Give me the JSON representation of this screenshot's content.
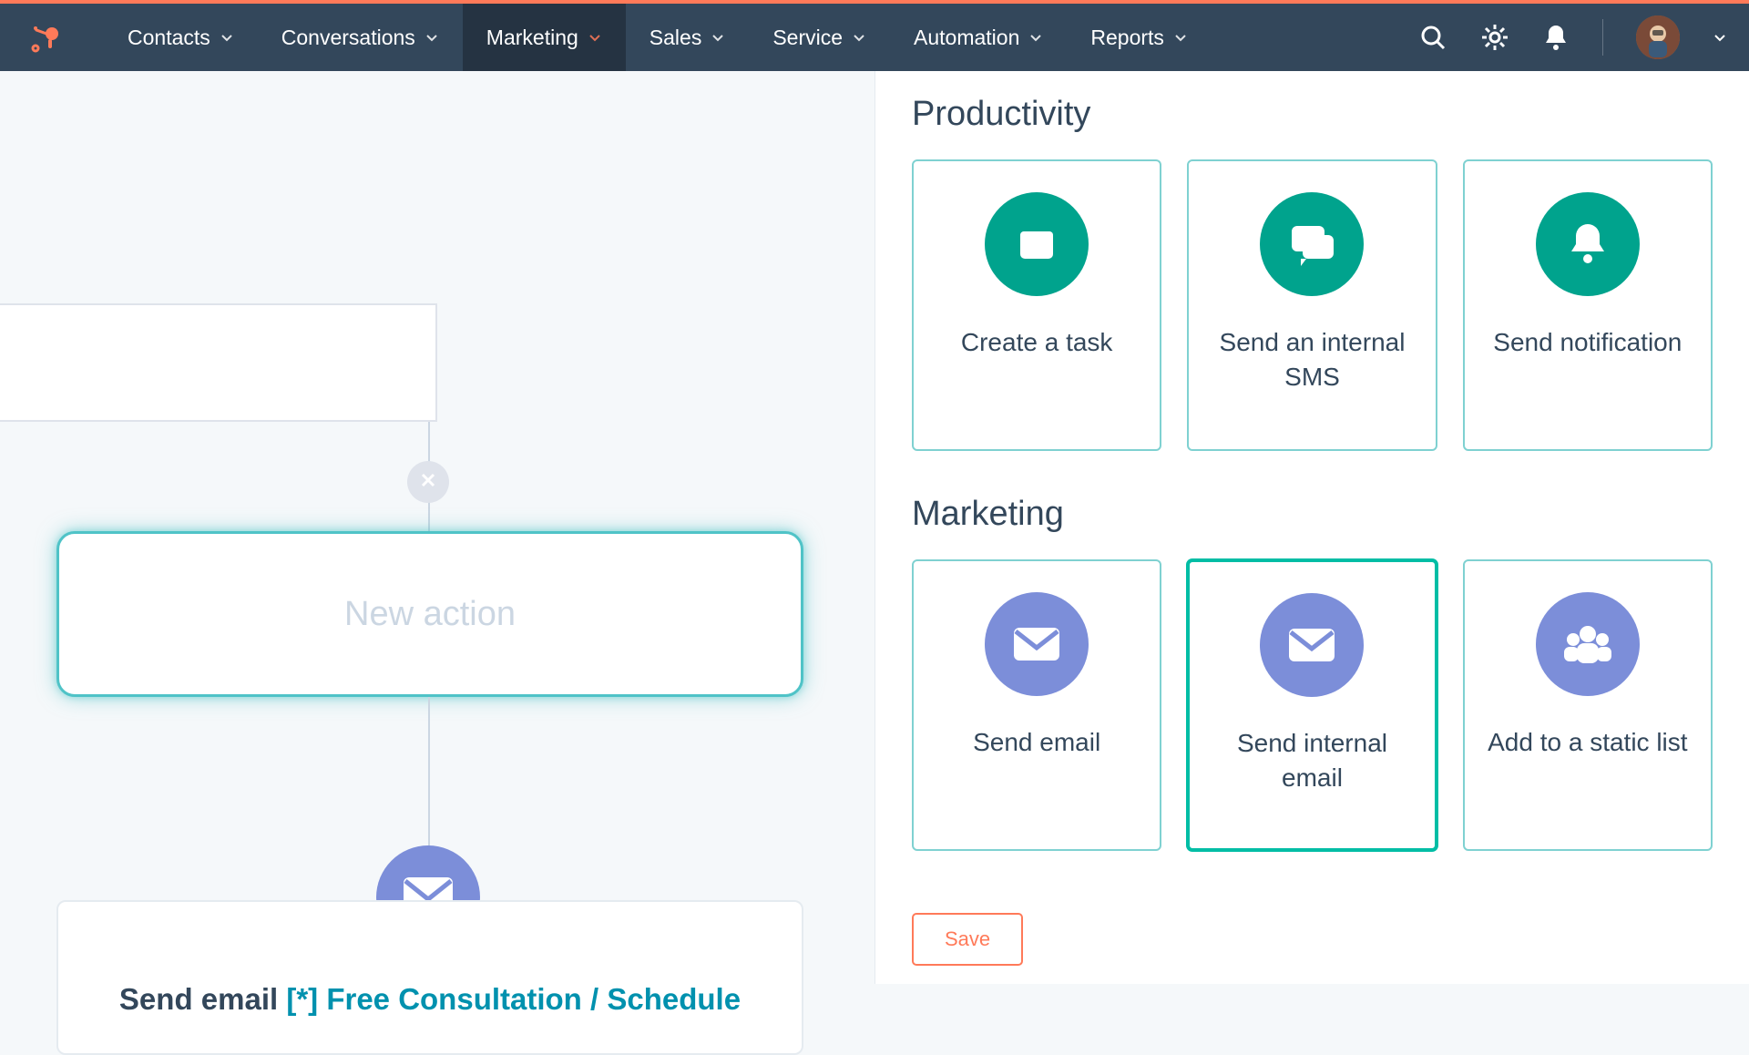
{
  "nav": {
    "items": [
      {
        "label": "Contacts"
      },
      {
        "label": "Conversations"
      },
      {
        "label": "Marketing"
      },
      {
        "label": "Sales"
      },
      {
        "label": "Service"
      },
      {
        "label": "Automation"
      },
      {
        "label": "Reports"
      }
    ]
  },
  "canvas": {
    "new_action_placeholder": "New action",
    "send_email_label": "Send email ",
    "send_email_template": "[*] Free Consultation / Schedule"
  },
  "panel": {
    "section_productivity": "Productivity",
    "section_marketing": "Marketing",
    "productivity_options": [
      {
        "label": "Create a task",
        "icon": "task"
      },
      {
        "label": "Send an internal SMS",
        "icon": "sms"
      },
      {
        "label": "Send notification",
        "icon": "bell"
      }
    ],
    "marketing_options": [
      {
        "label": "Send email",
        "icon": "mail"
      },
      {
        "label": "Send internal email",
        "icon": "mail"
      },
      {
        "label": "Add to a static list",
        "icon": "people"
      }
    ],
    "save_label": "Save"
  },
  "colors": {
    "brand_orange": "#ff7a59",
    "nav_bg": "#33475b",
    "teal": "#00a38d",
    "purple": "#7c8ed9",
    "link_teal": "#0091ae"
  }
}
